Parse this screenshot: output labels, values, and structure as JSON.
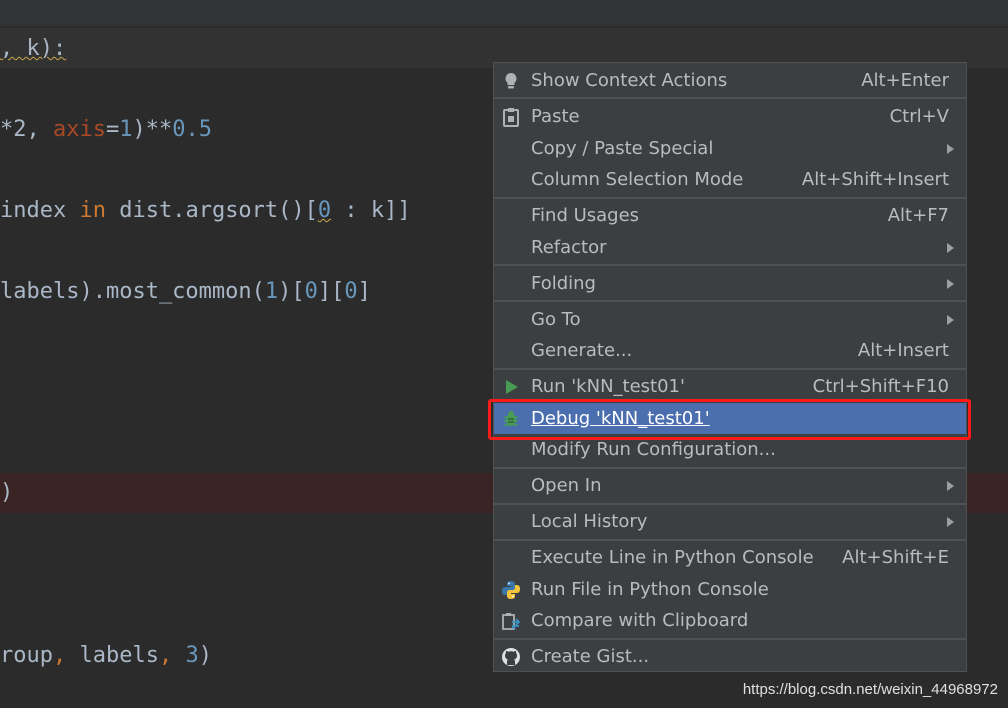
{
  "editor": {
    "lines": [
      {
        "a": ", k):"
      },
      {
        "a": "*2, ",
        "b": "axis",
        "c": "=",
        "d": "1",
        "e": ")**",
        "f": "0.5"
      },
      {
        "a": "index ",
        "b": "in",
        "c": " dist.argsort()[",
        "d": "0",
        "e": " : k]]"
      },
      {
        "a": "labels).most_common(",
        "b": "1",
        "c": ")[",
        "d": "0",
        "e": "][",
        "f": "0",
        "g": "]"
      },
      {
        "a": ")"
      },
      {
        "a": "roup",
        "b": ",",
        "c": " labels",
        "d": ",",
        "e": " ",
        "f": "3",
        "g": ")"
      }
    ]
  },
  "context_menu": {
    "items": [
      {
        "label": "Show Context Actions",
        "shortcut": "Alt+Enter",
        "icon": "lightbulb-icon"
      },
      {
        "label": "Paste",
        "shortcut": "Ctrl+V",
        "icon": "clipboard-icon"
      },
      {
        "label": "Copy / Paste Special",
        "submenu": true
      },
      {
        "label": "Column Selection Mode",
        "shortcut": "Alt+Shift+Insert"
      },
      {
        "label": "Find Usages",
        "shortcut": "Alt+F7"
      },
      {
        "label": "Refactor",
        "submenu": true
      },
      {
        "label": "Folding",
        "submenu": true
      },
      {
        "label": "Go To",
        "submenu": true
      },
      {
        "label": "Generate...",
        "shortcut": "Alt+Insert"
      },
      {
        "label": "Run 'kNN_test01'",
        "shortcut": "Ctrl+Shift+F10",
        "icon": "run-icon"
      },
      {
        "label": "Debug 'kNN_test01'",
        "icon": "debug-bug-icon",
        "selected": true
      },
      {
        "label": "Modify Run Configuration..."
      },
      {
        "label": "Open In",
        "submenu": true
      },
      {
        "label": "Local History",
        "submenu": true
      },
      {
        "label": "Execute Line in Python Console",
        "shortcut": "Alt+Shift+E"
      },
      {
        "label": "Run File in Python Console",
        "icon": "python-icon"
      },
      {
        "label": "Compare with Clipboard",
        "icon": "compare-icon"
      },
      {
        "label": "Create Gist...",
        "icon": "github-icon"
      }
    ]
  },
  "colors": {
    "selection": "#4b6eaf",
    "highlight_box": "#ff1a1a",
    "menu_bg": "#3c3f41"
  },
  "watermark": "https://blog.csdn.net/weixin_44968972"
}
